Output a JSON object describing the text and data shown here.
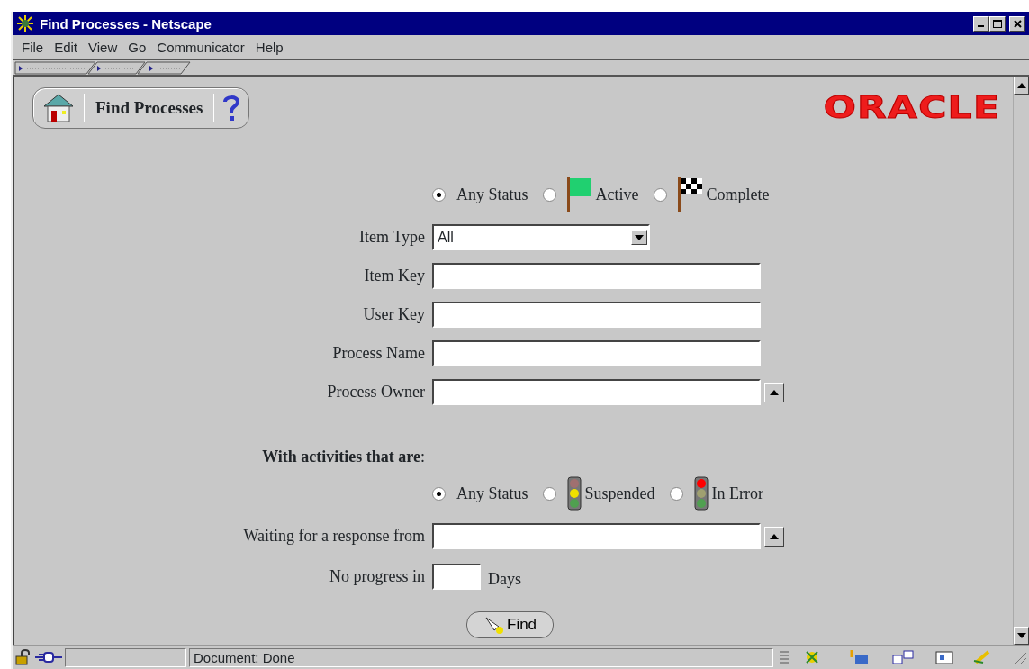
{
  "window": {
    "title": "Find Processes - Netscape"
  },
  "menu": [
    {
      "label": "File"
    },
    {
      "label": "Edit"
    },
    {
      "label": "View"
    },
    {
      "label": "Go"
    },
    {
      "label": "Communicator"
    },
    {
      "label": "Help"
    }
  ],
  "header": {
    "title": "Find Processes",
    "logo": "ORACLE"
  },
  "process_status": [
    {
      "label": "Any Status",
      "selected": true,
      "kind": "plain"
    },
    {
      "label": "Active",
      "selected": false,
      "kind": "flag"
    },
    {
      "label": "Complete",
      "selected": false,
      "kind": "checkered"
    }
  ],
  "fields": [
    {
      "label": "Item Type",
      "kind": "select",
      "value": "All"
    },
    {
      "label": "Item Key",
      "kind": "text"
    },
    {
      "label": "User Key",
      "kind": "text"
    },
    {
      "label": "Process Name",
      "kind": "text"
    },
    {
      "label": "Process Owner",
      "kind": "lookup"
    }
  ],
  "activities": {
    "heading": "**With activities that are**:",
    "status": [
      {
        "label": "Any Status",
        "selected": true,
        "kind": "plain"
      },
      {
        "label": "Suspended",
        "selected": false,
        "kind": "suspended"
      },
      {
        "label": "In Error",
        "selected": false,
        "kind": "error"
      }
    ],
    "waiting": {
      "label": "Waiting for a response from",
      "kind": "lookup"
    },
    "progress": {
      "label": "No progress in",
      "unit": "Days"
    }
  },
  "find_button": {
    "label": "Find"
  },
  "status_bar": {
    "text": "Document: Done"
  }
}
